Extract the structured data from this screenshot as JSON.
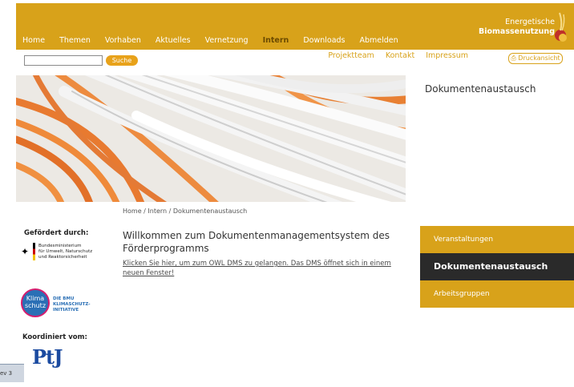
{
  "header": {
    "nav": [
      "Home",
      "Themen",
      "Vorhaben",
      "Aktuelles",
      "Vernetzung",
      "Intern",
      "Downloads",
      "Abmelden"
    ],
    "active_nav": "Intern",
    "logo_line1": "Energetische",
    "logo_line2": "Biomassenutzung",
    "brand_color": "#d8a21a"
  },
  "search": {
    "placeholder": "",
    "button_label": "Suche"
  },
  "toplinks": [
    "Projektteam",
    "Kontakt",
    "Impressum"
  ],
  "print_label": "Druckansicht",
  "sidebar_title": "Dokumentenaustausch",
  "breadcrumb": "Home / Intern / Dokumentenaustausch",
  "funding": {
    "label": "Gefördert durch:",
    "ministry_lines": [
      "Bundesministerium",
      "für Umwelt, Naturschutz",
      "und Reaktorsicherheit"
    ],
    "klima_logo": "Klima schutz",
    "klima_text": [
      "DIE BMU",
      "KLIMASCHUTZ-",
      "INITIATIVE"
    ]
  },
  "coordination": {
    "label": "Koordiniert vom:",
    "ptj_logo": "PtJ"
  },
  "main": {
    "title": "Willkommen zum Dokumentenmanagementsystem des Förderprogramms",
    "link": "Klicken Sie hier, um zum OWL DMS zu gelangen. Das DMS öffnet sich in einem neuen Fenster!"
  },
  "side_menu": [
    {
      "label": "Veranstaltungen",
      "active": false
    },
    {
      "label": "Dokumentenaustausch",
      "active": true
    },
    {
      "label": "Arbeitsgruppen",
      "active": false
    }
  ],
  "taskbar_text": "ev 3"
}
